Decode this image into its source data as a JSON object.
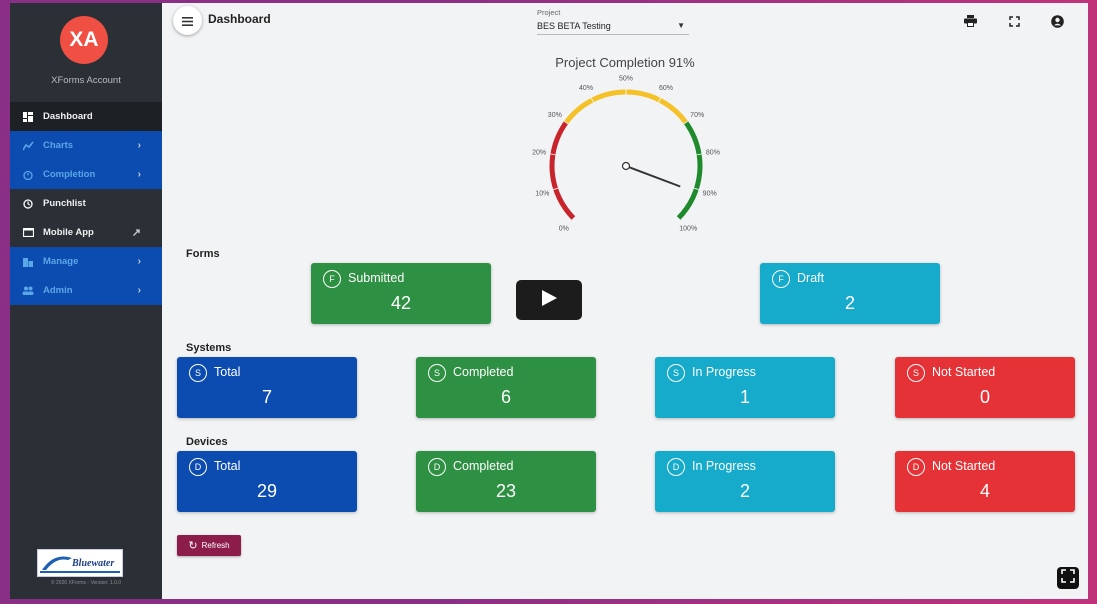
{
  "sidebar": {
    "avatar_initials": "XA",
    "account_name": "XForms Account",
    "items": [
      {
        "label": "Dashboard",
        "icon": "dashboard-icon"
      },
      {
        "label": "Charts",
        "icon": "chart-icon"
      },
      {
        "label": "Completion",
        "icon": "timer-icon"
      },
      {
        "label": "Punchlist",
        "icon": "clock-icon"
      },
      {
        "label": "Mobile App",
        "icon": "tablet-icon"
      },
      {
        "label": "Manage",
        "icon": "building-icon"
      },
      {
        "label": "Admin",
        "icon": "people-icon"
      }
    ],
    "logo_text": "Bluewater",
    "version": "© 2020 XForms - Version: 1.0.0"
  },
  "header": {
    "title": "Dashboard",
    "project_label": "Project",
    "project_value": "BES BETA Testing"
  },
  "gauge": {
    "title": "Project Completion 91%",
    "value": 91,
    "tick_labels": [
      "0%",
      "10%",
      "20%",
      "30%",
      "40%",
      "50%",
      "60%",
      "70%",
      "80%",
      "90%",
      "100%"
    ],
    "band_colors": {
      "red": "#c8242b",
      "yellow": "#f5c128",
      "green": "#1e8a2b"
    }
  },
  "forms": {
    "section_label": "Forms",
    "cards": [
      {
        "badge": "F",
        "label": "Submitted",
        "value": "42"
      },
      {
        "badge": "F",
        "label": "Draft",
        "value": "2"
      }
    ]
  },
  "systems": {
    "section_label": "Systems",
    "cards": [
      {
        "badge": "S",
        "label": "Total",
        "value": "7"
      },
      {
        "badge": "S",
        "label": "Completed",
        "value": "6"
      },
      {
        "badge": "S",
        "label": "In Progress",
        "value": "1"
      },
      {
        "badge": "S",
        "label": "Not Started",
        "value": "0"
      }
    ]
  },
  "devices": {
    "section_label": "Devices",
    "cards": [
      {
        "badge": "D",
        "label": "Total",
        "value": "29"
      },
      {
        "badge": "D",
        "label": "Completed",
        "value": "23"
      },
      {
        "badge": "D",
        "label": "In Progress",
        "value": "2"
      },
      {
        "badge": "D",
        "label": "Not Started",
        "value": "4"
      }
    ]
  },
  "refresh_label": "Refresh"
}
